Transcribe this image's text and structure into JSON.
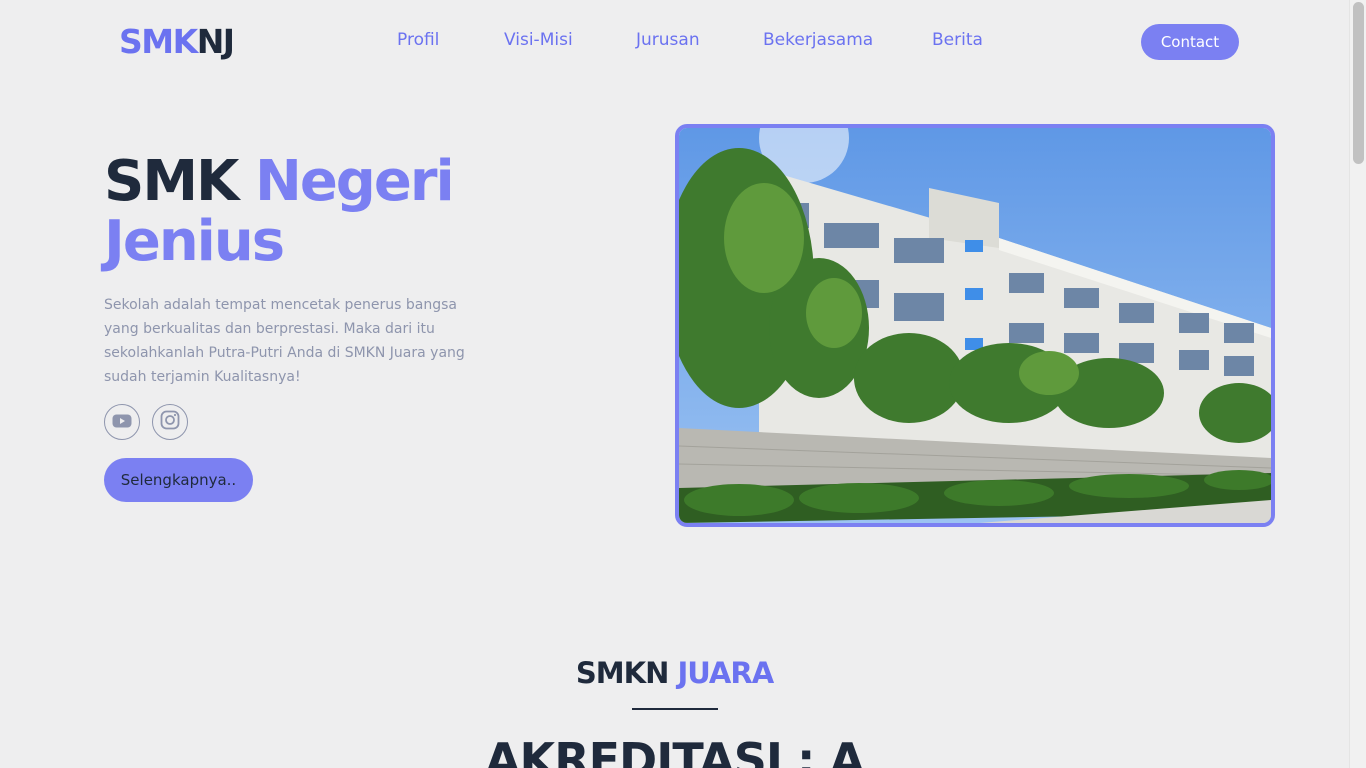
{
  "brand": {
    "logo_part1": "SMK",
    "logo_part2": "NJ"
  },
  "nav": {
    "items": [
      {
        "label": "Profil"
      },
      {
        "label": "Visi-Misi"
      },
      {
        "label": "Jurusan"
      },
      {
        "label": "Bekerjasama"
      },
      {
        "label": "Berita"
      }
    ],
    "contact_label": "Contact"
  },
  "hero": {
    "title_part1": "SMK",
    "title_part2": "Negeri",
    "title_part3": "Jenius",
    "description": "Sekolah adalah tempat mencetak penerus bangsa yang berkualitas dan berprestasi. Maka dari itu sekolahkanlah Putra-Putri Anda di SMKN Juara yang sudah terjamin Kualitasnya!",
    "social": [
      {
        "icon": "youtube-icon"
      },
      {
        "icon": "instagram-icon"
      }
    ],
    "button_label": "Selengkapnya.."
  },
  "section": {
    "title_part1": "SMKN",
    "title_part2": "JUARA",
    "accreditation": "AKREDITASI : A"
  },
  "colors": {
    "accent": "#7b80f2",
    "accent_dark": "#6b72f0",
    "text_dark": "#1f2a3c",
    "text_muted": "#8e95ad",
    "background": "#eeeeef"
  }
}
